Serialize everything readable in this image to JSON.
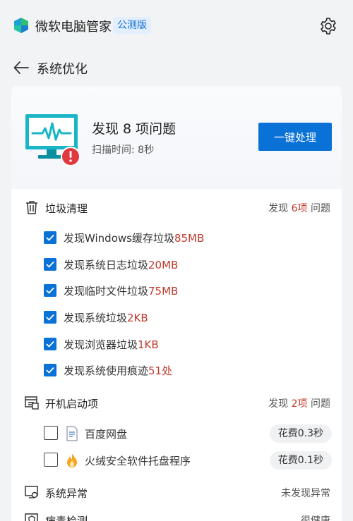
{
  "app": {
    "title": "微软电脑管家",
    "edition": "公测版"
  },
  "page": {
    "title": "系统优化"
  },
  "result": {
    "title": "发现 8 项问题",
    "scan_time": "扫描时间: 8秒",
    "fix_label": "一键处理"
  },
  "junk": {
    "title": "垃圾清理",
    "summary_prefix": "发现 ",
    "summary_count": "6项",
    "summary_suffix": " 问题",
    "items": [
      {
        "text": "发现Windows缓存垃圾",
        "value": "85MB"
      },
      {
        "text": "发现系统日志垃圾",
        "value": "20MB"
      },
      {
        "text": "发现临时文件垃圾",
        "value": "75MB"
      },
      {
        "text": "发现系统垃圾",
        "value": "2KB"
      },
      {
        "text": "发现浏览器垃圾",
        "value": "1KB"
      },
      {
        "text": "发现系统使用痕迹",
        "value": "51处"
      }
    ]
  },
  "startup": {
    "title": "开机启动项",
    "summary_prefix": "发现 ",
    "summary_count": "2项",
    "summary_suffix": " 问题",
    "items": [
      {
        "name": "百度网盘",
        "cost": "花费0.3秒",
        "icon": "document-icon"
      },
      {
        "name": "火绒安全软件托盘程序",
        "cost": "花费0.1秒",
        "icon": "flame-icon"
      }
    ]
  },
  "system_anomaly": {
    "title": "系统异常",
    "status": "未发现异常"
  },
  "virus": {
    "title": "病毒检测",
    "status": "很健康"
  },
  "colors": {
    "accent": "#0a72d6",
    "highlight_red": "#c0392b",
    "alert_red": "#e0393e",
    "monitor_teal": "#19b5c7"
  }
}
